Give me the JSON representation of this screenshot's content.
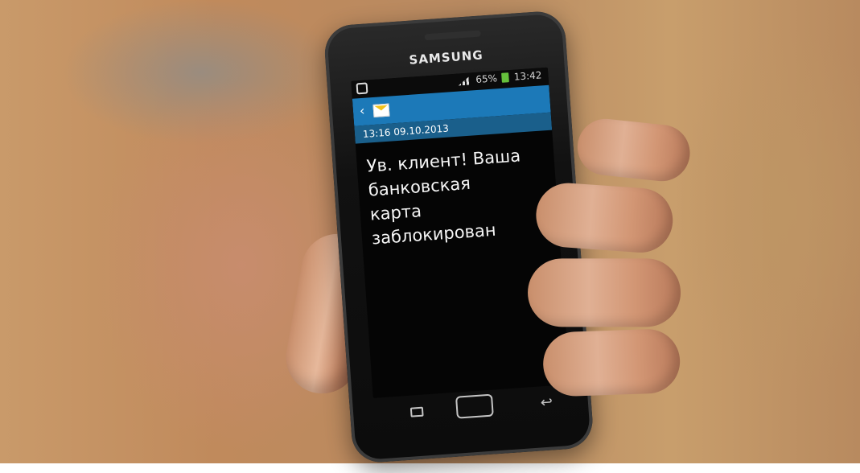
{
  "phone": {
    "brand": "SAMSUNG",
    "status_time": "13:42",
    "battery_percent": "65%",
    "message_timestamp": "13:16 09.10.2013",
    "message_text": "Ув. клиент! Ваша\nбанковская\nкарта\nзаблокирован"
  }
}
